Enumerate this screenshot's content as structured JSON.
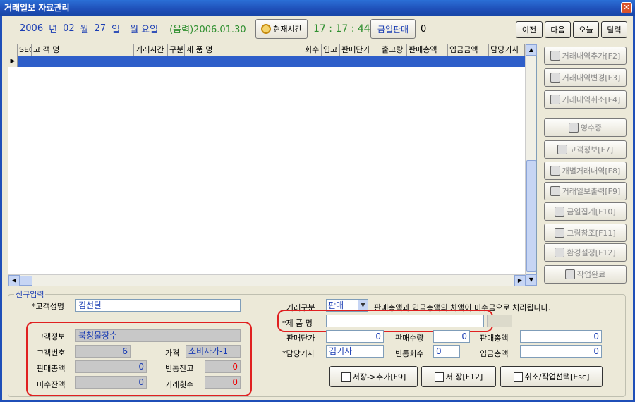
{
  "window": {
    "title": "거래일보 자료관리",
    "close": "✕"
  },
  "datebar": {
    "year": "2006",
    "year_unit": "년",
    "month": "02",
    "month_unit": "월",
    "day": "27",
    "day_unit": "일",
    "weekday": "월 요일",
    "lunar": "(음력)2006.01.30",
    "now_btn": "현재시간",
    "time": "17 : 17 : 44",
    "today_sales_btn": "금일판매",
    "today_sales_value": "0"
  },
  "nav": {
    "prev": "이전",
    "next": "다음",
    "today": "오늘",
    "calendar": "달력"
  },
  "grid": {
    "columns": [
      "SEQ",
      "고 객 명",
      "거래시간",
      "구분",
      "제    품    명",
      "회수",
      "입고",
      "판매단가",
      "출고량",
      "판매총액",
      "입금금액",
      "담당기사"
    ],
    "row_marker": "▶"
  },
  "side": [
    {
      "label": "거래내역추가[F2]",
      "icon": "add-record-icon"
    },
    {
      "label": "거래내역변경[F3]",
      "icon": "edit-record-icon"
    },
    {
      "label": "거래내역취소[F4]",
      "icon": "cancel-record-icon"
    },
    {
      "label": "영수증",
      "icon": "receipt-icon"
    },
    {
      "label": "고객정보[F7]",
      "icon": "customer-info-icon"
    },
    {
      "label": "개별거래내역[F8]",
      "icon": "individual-history-icon"
    },
    {
      "label": "거래일보출력[F9]",
      "icon": "print-icon"
    },
    {
      "label": "금일집계[F10]",
      "icon": "summary-icon"
    },
    {
      "label": "그림참조[F11]",
      "icon": "image-reference-icon"
    },
    {
      "label": "환경설정[F12]",
      "icon": "settings-icon"
    },
    {
      "label": "작업완료",
      "icon": "exit-door-icon"
    }
  ],
  "form": {
    "group_title": "신규입력",
    "customer_name_label": "*고객성명",
    "customer_name": "김선달",
    "customer_info_label": "고객정보",
    "customer_info": "북청물장수",
    "customer_no_label": "고객번호",
    "customer_no": "6",
    "price_label": "가격",
    "price": "소비자가-1",
    "sales_total_label": "판매총액",
    "sales_total": "0",
    "bottle_balance_label": "빈통잔고",
    "bottle_balance": "0",
    "unpaid_label": "미수잔액",
    "unpaid": "0",
    "trade_count_label": "거래횟수",
    "trade_count": "0",
    "trade_type_label": "거래구분",
    "trade_type": "판매",
    "trade_type_note": "판매총액과 입금총액의 차액이 미수금으로 처리됩니다.",
    "product_label": "*제 품 명",
    "product": "",
    "unit_price_label": "판매단가",
    "unit_price": "0",
    "qty_label": "판매수량",
    "qty": "0",
    "sales_amount_label": "판매총액",
    "sales_amount": "0",
    "driver_label": "*담당기사",
    "driver": "김기사",
    "bottle_return_label": "빈통회수",
    "bottle_return": "0",
    "deposit_label": "입금총액",
    "deposit": "0",
    "save_add_btn": "저장->추가[F9]",
    "save_btn": "저 장[F12]",
    "cancel_btn": "취소/작업선택[Esc]"
  }
}
